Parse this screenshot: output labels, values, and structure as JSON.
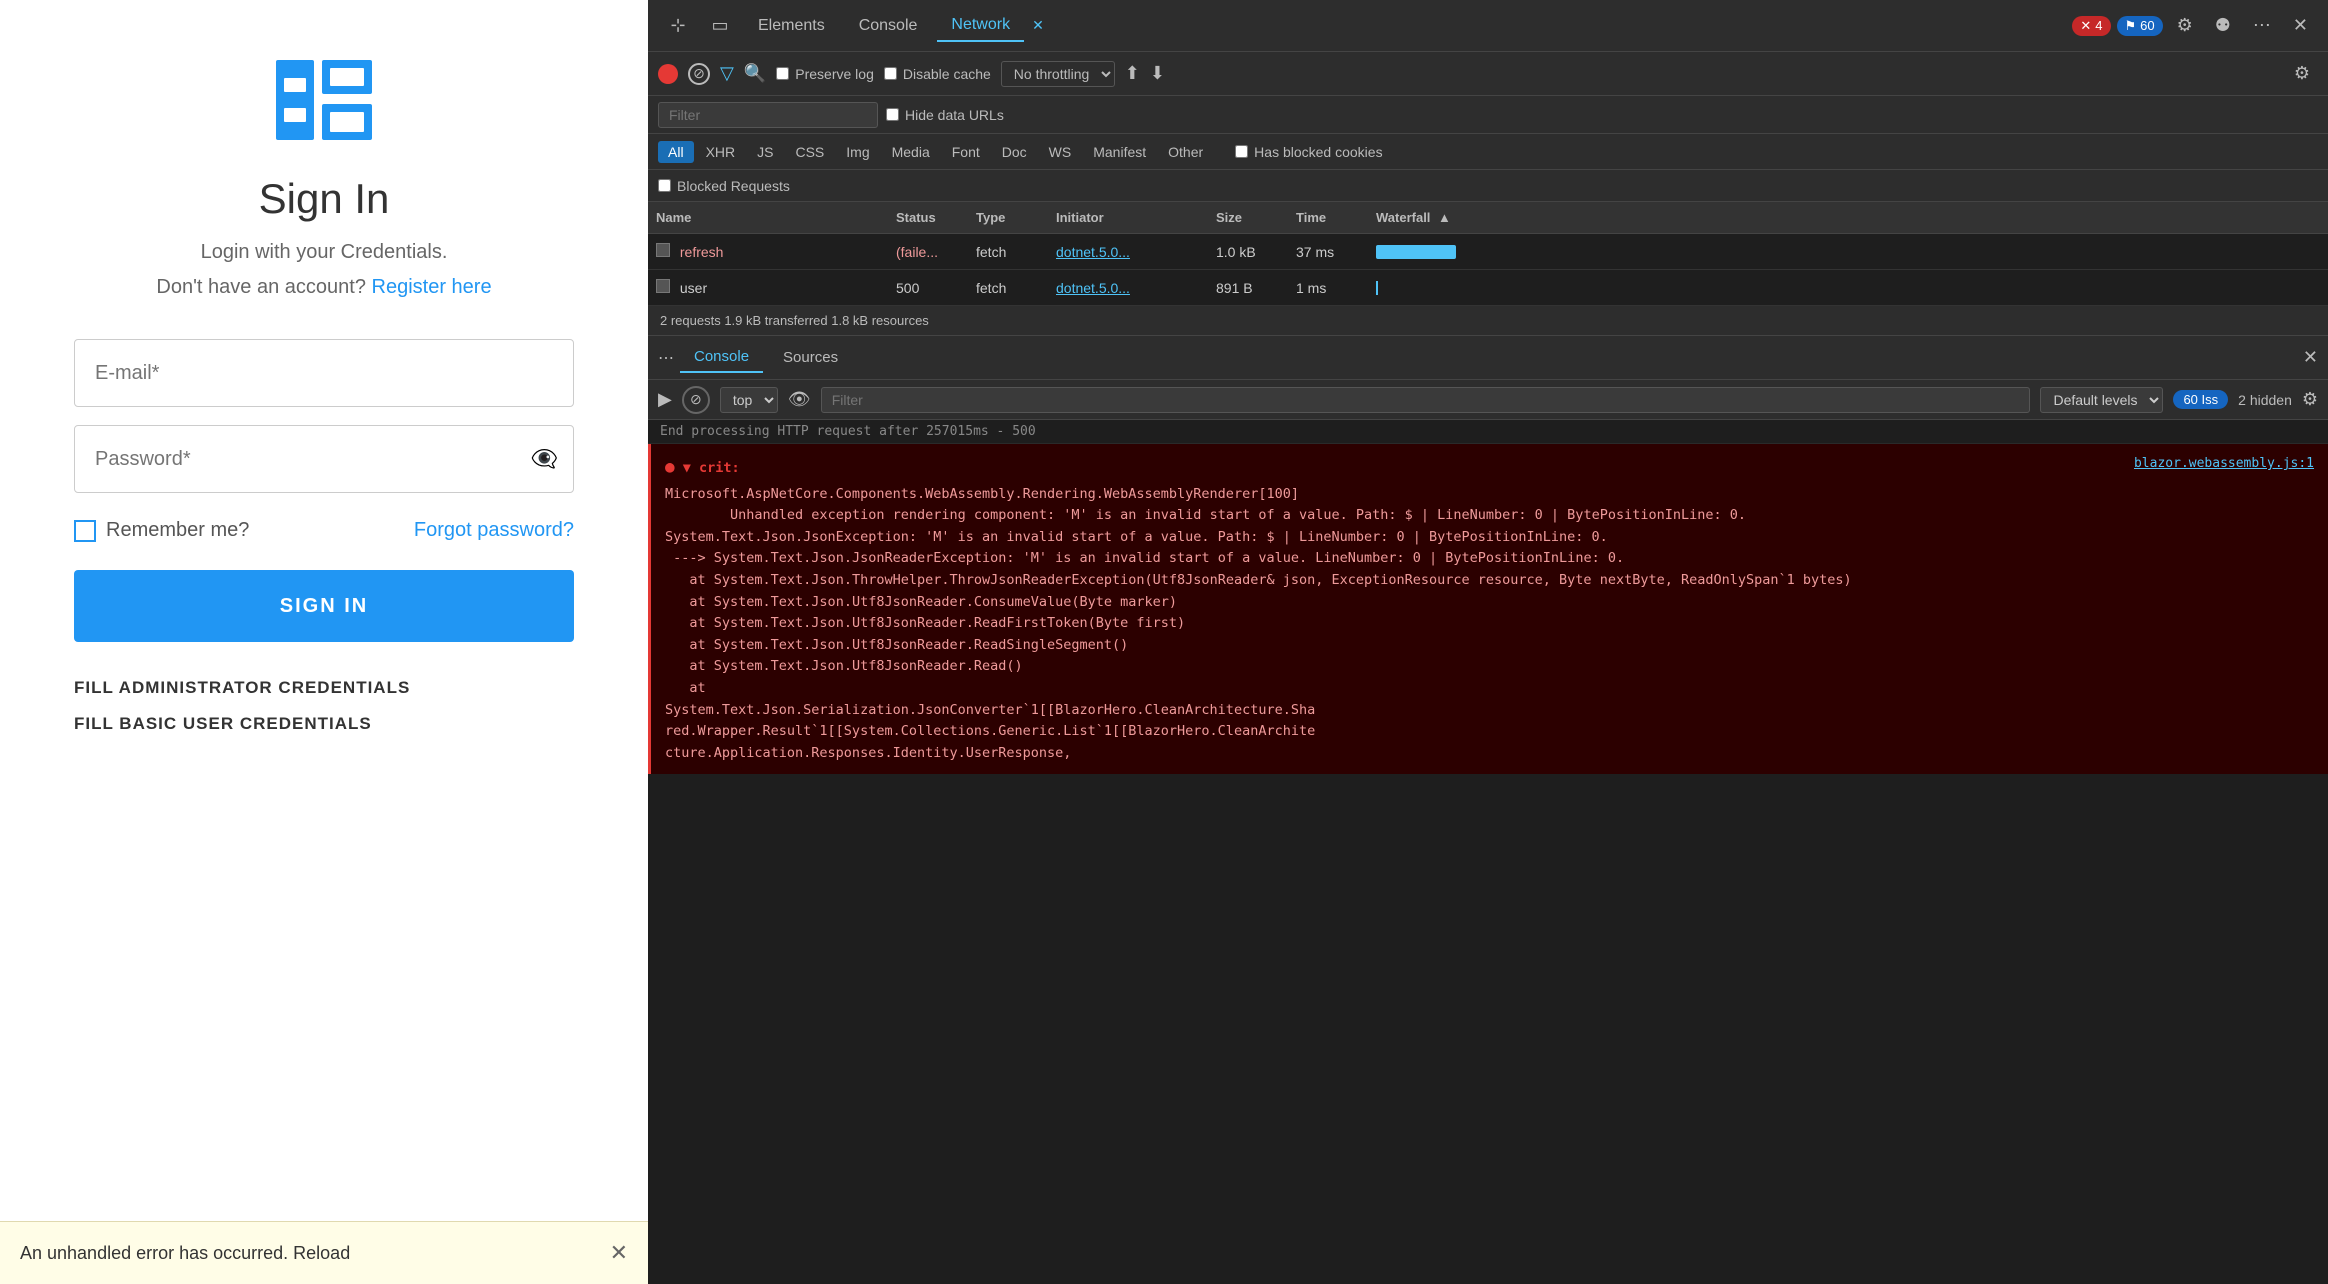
{
  "app": {
    "title": "Sign In",
    "subtitle": "Login with your Credentials.",
    "register_text": "Don't have an account?",
    "register_link": "Register here",
    "email_placeholder": "E-mail*",
    "password_placeholder": "Password*",
    "remember_label": "Remember me?",
    "forgot_label": "Forgot password?",
    "sign_in_button": "SIGN IN",
    "fill_admin": "FILL ADMINISTRATOR CREDENTIALS",
    "fill_basic": "FILL BASIC USER CREDENTIALS",
    "error_bar": "An unhandled error has occurred. Reload"
  },
  "devtools": {
    "tabs": [
      "Elements",
      "Console",
      "Network"
    ],
    "active_tab": "Network",
    "badge_red": "4",
    "badge_blue": "60",
    "toolbar": {
      "preserve_log": "Preserve log",
      "disable_cache": "Disable cache",
      "no_throttling": "No throttling"
    },
    "filter_placeholder": "Filter",
    "hide_data_urls": "Hide data URLs",
    "type_filters": [
      "All",
      "XHR",
      "JS",
      "CSS",
      "Img",
      "Media",
      "Font",
      "Doc",
      "WS",
      "Manifest",
      "Other"
    ],
    "active_type": "All",
    "has_blocked": "Has blocked cookies",
    "blocked_requests": "Blocked Requests",
    "table": {
      "headers": [
        "Name",
        "Status",
        "Type",
        "Initiator",
        "Size",
        "Time",
        "Waterfall"
      ],
      "rows": [
        {
          "name": "refresh",
          "status": "(faile...",
          "type": "fetch",
          "initiator": "dotnet.5.0...",
          "size": "1.0 kB",
          "time": "37 ms",
          "has_bar": true,
          "failed": true
        },
        {
          "name": "user",
          "status": "500",
          "type": "fetch",
          "initiator": "dotnet.5.0...",
          "size": "891 B",
          "time": "1 ms",
          "has_bar": false,
          "failed": false
        }
      ]
    },
    "summary": "2 requests  1.9 kB transferred  1.8 kB resources"
  },
  "console": {
    "tabs": [
      "Console",
      "Sources"
    ],
    "active_tab": "Console",
    "context": "top",
    "filter_placeholder": "Filter",
    "default_levels": "Default levels",
    "issues_count": "60 Iss",
    "hidden_count": "2 hidden",
    "prev_msg": "End processing HTTP request after 257015ms - 500",
    "error": {
      "crit_label": "▼ crit:",
      "source_link": "blazor.webassembly.js:1",
      "text": "Microsoft.AspNetCore.Components.WebAssembly.Rendering.WebAssemblyRenderer[100]\n        Unhandled exception rendering component: 'M' is an invalid start of a value. Path: $ | LineNumber: 0 | BytePositionInLine: 0.\nSystem.Text.Json.JsonException: 'M' is an invalid start of a value. Path: $ | LineNumber: 0 | BytePositionInLine: 0.\n ---> System.Text.Json.JsonReaderException: 'M' is an invalid start of a value. LineNumber: 0 | BytePositionInLine: 0.\n   at System.Text.Json.ThrowHelper.ThrowJsonReaderException(Utf8JsonReader& json, ExceptionResource resource, Byte nextByte, ReadOnlySpan`1 bytes)\n   at System.Text.Json.Utf8JsonReader.ConsumeValue(Byte marker)\n   at System.Text.Json.Utf8JsonReader.ReadFirstToken(Byte first)\n   at System.Text.Json.Utf8JsonReader.ReadSingleSegment()\n   at System.Text.Json.Utf8JsonReader.Read()\n   at\nSystem.Text.Json.Serialization.JsonConverter`1[[BlazorHero.CleanArchitecture.Sha\nred.Wrapper.Result`1[[System.Collections.Generic.List`1[[BlazorHero.CleanArchite\ncture.Application.Responses.Identity.UserResponse,"
    }
  }
}
